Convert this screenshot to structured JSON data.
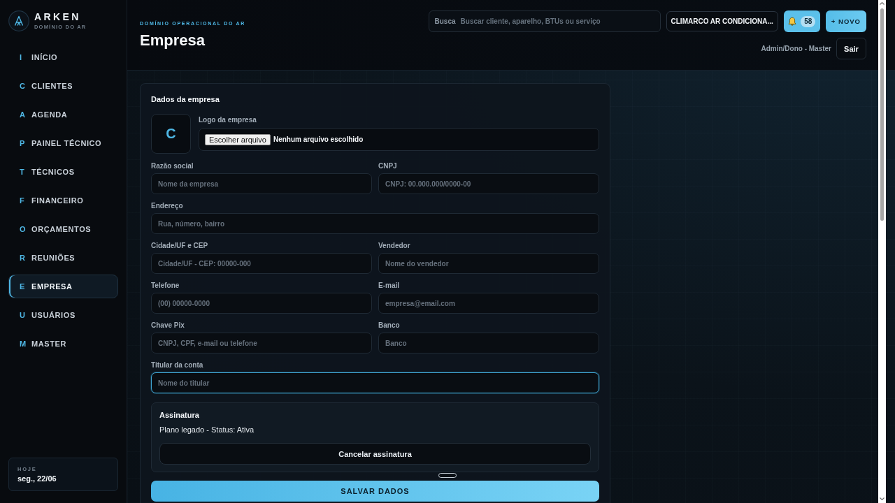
{
  "sidebar": {
    "brand": {
      "name": "ARKEN",
      "tagline": "DOMÍNIO DO AR"
    },
    "items": [
      {
        "letter": "I",
        "label": "INÍCIO",
        "selected": false
      },
      {
        "letter": "C",
        "label": "CLIENTES",
        "selected": false
      },
      {
        "letter": "A",
        "label": "AGENDA",
        "selected": false
      },
      {
        "letter": "P",
        "label": "PAINEL TÉCNICO",
        "selected": false
      },
      {
        "letter": "T",
        "label": "TÉCNICOS",
        "selected": false
      },
      {
        "letter": "F",
        "label": "FINANCEIRO",
        "selected": false
      },
      {
        "letter": "O",
        "label": "ORÇAMENTOS",
        "selected": false
      },
      {
        "letter": "R",
        "label": "REUNIÕES",
        "selected": false
      },
      {
        "letter": "E",
        "label": "EMPRESA",
        "selected": true
      },
      {
        "letter": "U",
        "label": "USUÁRIOS",
        "selected": false
      },
      {
        "letter": "M",
        "label": "MASTER",
        "selected": false
      }
    ],
    "today": {
      "label": "HOJE",
      "date": "seg., 22/06"
    }
  },
  "header": {
    "eyebrow": "DOMÍNIO OPERACIONAL DO AR",
    "title": "Empresa",
    "search": {
      "label": "Busca",
      "placeholder": "Buscar cliente, aparelho, BTUs ou serviço"
    },
    "company_button": "CLIMARCO AR CONDICIONA...",
    "notifications": {
      "count": "58"
    },
    "new_button": "+ NOVO",
    "user": "Admin/Dono - Master",
    "logout_button": "Sair"
  },
  "company_form": {
    "title": "Dados da empresa",
    "logo": {
      "initial": "C",
      "label": "Logo da empresa",
      "file_button": "Escolher arquivo",
      "file_status": "Nenhum arquivo escolhido"
    },
    "rows": [
      {
        "fields": [
          {
            "label": "Razão social",
            "placeholder": "Nome da empresa",
            "focused": false
          },
          {
            "label": "CNPJ",
            "placeholder": "CNPJ: 00.000.000/0000-00",
            "focused": false
          }
        ]
      },
      {
        "fields": [
          {
            "label": "Endereço",
            "placeholder": "Rua, número, bairro",
            "focused": false
          }
        ]
      },
      {
        "fields": [
          {
            "label": "Cidade/UF e CEP",
            "placeholder": "Cidade/UF - CEP: 00000-000",
            "focused": false
          },
          {
            "label": "Vendedor",
            "placeholder": "Nome do vendedor",
            "focused": false
          }
        ]
      },
      {
        "fields": [
          {
            "label": "Telefone",
            "placeholder": "(00) 00000-0000",
            "focused": false
          },
          {
            "label": "E-mail",
            "placeholder": "empresa@email.com",
            "focused": false
          }
        ]
      },
      {
        "fields": [
          {
            "label": "Chave Pix",
            "placeholder": "CNPJ, CPF, e-mail ou telefone",
            "focused": false
          },
          {
            "label": "Banco",
            "placeholder": "Banco",
            "focused": false
          }
        ]
      },
      {
        "fields": [
          {
            "label": "Titular da conta",
            "placeholder": "Nome do titular",
            "focused": true
          }
        ]
      }
    ],
    "subscription": {
      "title": "Assinatura",
      "status": "Plano legado - Status: Ativa",
      "cancel_button": "Cancelar assinatura"
    },
    "save_button": "SALVAR DADOS"
  }
}
